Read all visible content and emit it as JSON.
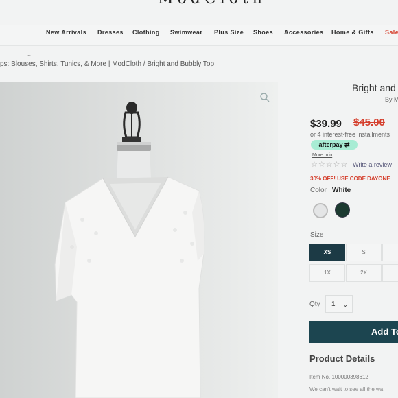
{
  "header": {
    "logo_fragment": "ModCloth"
  },
  "nav": {
    "items": [
      {
        "label": "New Arrivals"
      },
      {
        "label": "Dresses"
      },
      {
        "label": "Clothing"
      },
      {
        "label": "Swimwear"
      },
      {
        "label": "Plus Size"
      },
      {
        "label": "Shoes"
      },
      {
        "label": "Accessories"
      },
      {
        "label": "Home & Gifts"
      },
      {
        "label": "Sale"
      }
    ]
  },
  "breadcrumb": {
    "text": "ps: Blouses, Shirts, Tunics, & More | ModCloth / Bright and Bubbly Top",
    "tick": "~"
  },
  "product": {
    "title": "Bright and",
    "byline": "By M",
    "price": "$39.99",
    "original_price": "$45.00",
    "installments": "or 4 interest-free installments",
    "afterpay_label": "afterpay",
    "more_info": "More info",
    "stars": "☆☆☆☆☆",
    "write_review": "Write a review",
    "promo": "30% OFF! USE CODE DAYONE",
    "color_label": "Color",
    "color_value": "White",
    "colors": [
      "#e4e5e6",
      "#1c3a30"
    ],
    "size_label": "Size",
    "sizes": [
      "XS",
      "S",
      "1X",
      "2X"
    ],
    "selected_size": "XS",
    "qty_label": "Qty",
    "qty_value": "1",
    "add_button": "Add To",
    "details_heading": "Product Details",
    "item_no": "Item No. 100000398612",
    "description": "We can't wait to see all the wa"
  }
}
